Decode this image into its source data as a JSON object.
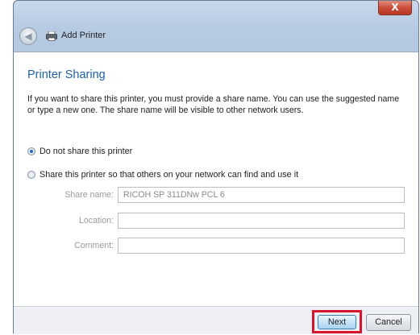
{
  "window": {
    "title": "Add Printer",
    "close_label": "X"
  },
  "page": {
    "heading": "Printer Sharing",
    "description": "If you want to share this printer, you must provide a share name. You can use the suggested name or type a new one. The share name will be visible to other network users."
  },
  "options": [
    {
      "label": "Do not share this printer",
      "checked": true
    },
    {
      "label": "Share this printer so that others on your network can find and use it",
      "checked": false
    }
  ],
  "fields": {
    "share_name": {
      "label": "Share name:",
      "value": "RICOH SP 311DNw PCL 6"
    },
    "location": {
      "label": "Location:",
      "value": ""
    },
    "comment": {
      "label": "Comment:",
      "value": ""
    }
  },
  "footer": {
    "next_label": "Next",
    "cancel_label": "Cancel"
  },
  "colors": {
    "heading": "#1e5fa8",
    "highlight": "#d8162b",
    "close": "#c94a36"
  }
}
